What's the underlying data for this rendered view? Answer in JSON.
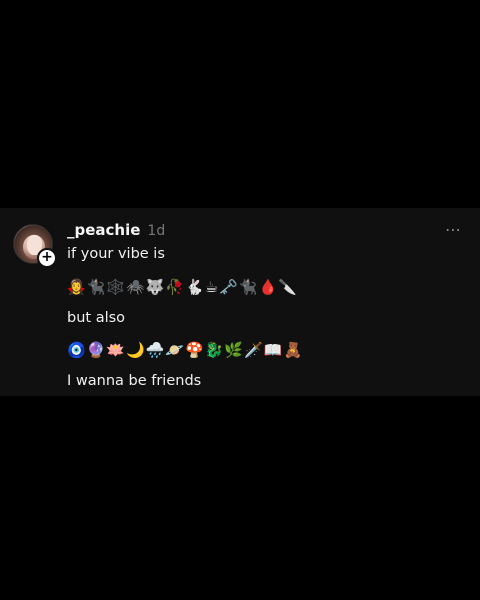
{
  "post": {
    "username": "_peachie",
    "time": "1d",
    "more_icon": "⋯",
    "lines": [
      "if your vibe is",
      "but also",
      "I wanna be friends"
    ],
    "emoji_row_1": "🧛‍♀️🐈‍⬛🕸️🕷️🐺🥀🐇☕🗝️🐈‍⬛🩸🔪",
    "emoji_row_2": "🧿🔮🪷🌙🌧️🪐🍄🐉🌿🗡️📖🧸",
    "plus": "+"
  }
}
